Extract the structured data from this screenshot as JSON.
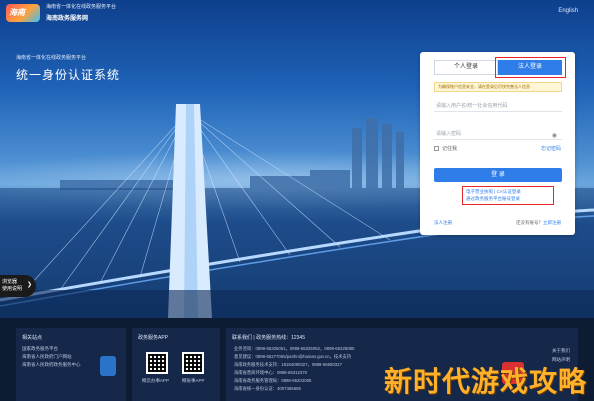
{
  "header": {
    "logo_text": "海南",
    "brand_line1": "海南省一体化在线政务服务平台",
    "brand_line2": "海南政务服务网",
    "lang": "English"
  },
  "hero": {
    "subtitle": "海南省一体化在线政务服务平台",
    "title": "统一身份认证系统",
    "browser_tip_line1": "浏览器",
    "browser_tip_line2": "使用说明"
  },
  "login": {
    "tab_personal": "个人登录",
    "tab_legal": "法人登录",
    "notice": "为确保账户信息安全，请在登录后尽快完善法人信息",
    "username_placeholder": "请输入用户名/统一社会信用代码",
    "password_placeholder": "请输入密码",
    "remember": "记住我",
    "forgot": "忘记密码",
    "submit": "登 录",
    "alt_line1": "电子营业执照 | CA认证登录",
    "alt_line2": "通过政务服务平台账号登录",
    "register": "法人注册",
    "footer_prefix": "还没有账号？",
    "footer_link": "立即注册"
  },
  "footer": {
    "links_title": "相关站点",
    "links": [
      "国家政务服务平台",
      "海南省人民政府门户网站",
      "海南省人民政府政务服务中心"
    ],
    "app_title": "政务服务APP",
    "app_labels": [
      "椰云办事APP",
      "椰省事APP"
    ],
    "contact_title": "联系我们 | 政务服务热线：12345",
    "contact_lines": [
      "业务咨询：0898-65325051，0898-65325052，0898-65325080",
      "意见建议：0898-65277065/panhn@hainan.gov.cn，技术支持",
      "海南政务服务技术支持：18184090327，0898-66550327",
      "海南省营商环境中心：0898-65312370",
      "海南省政务服务管理局：0898-65202005",
      "海南省统一身份认证：4007365656"
    ],
    "about_title": "关于我们",
    "about_link": "网站声明"
  },
  "watermark": "新时代游戏攻略"
}
